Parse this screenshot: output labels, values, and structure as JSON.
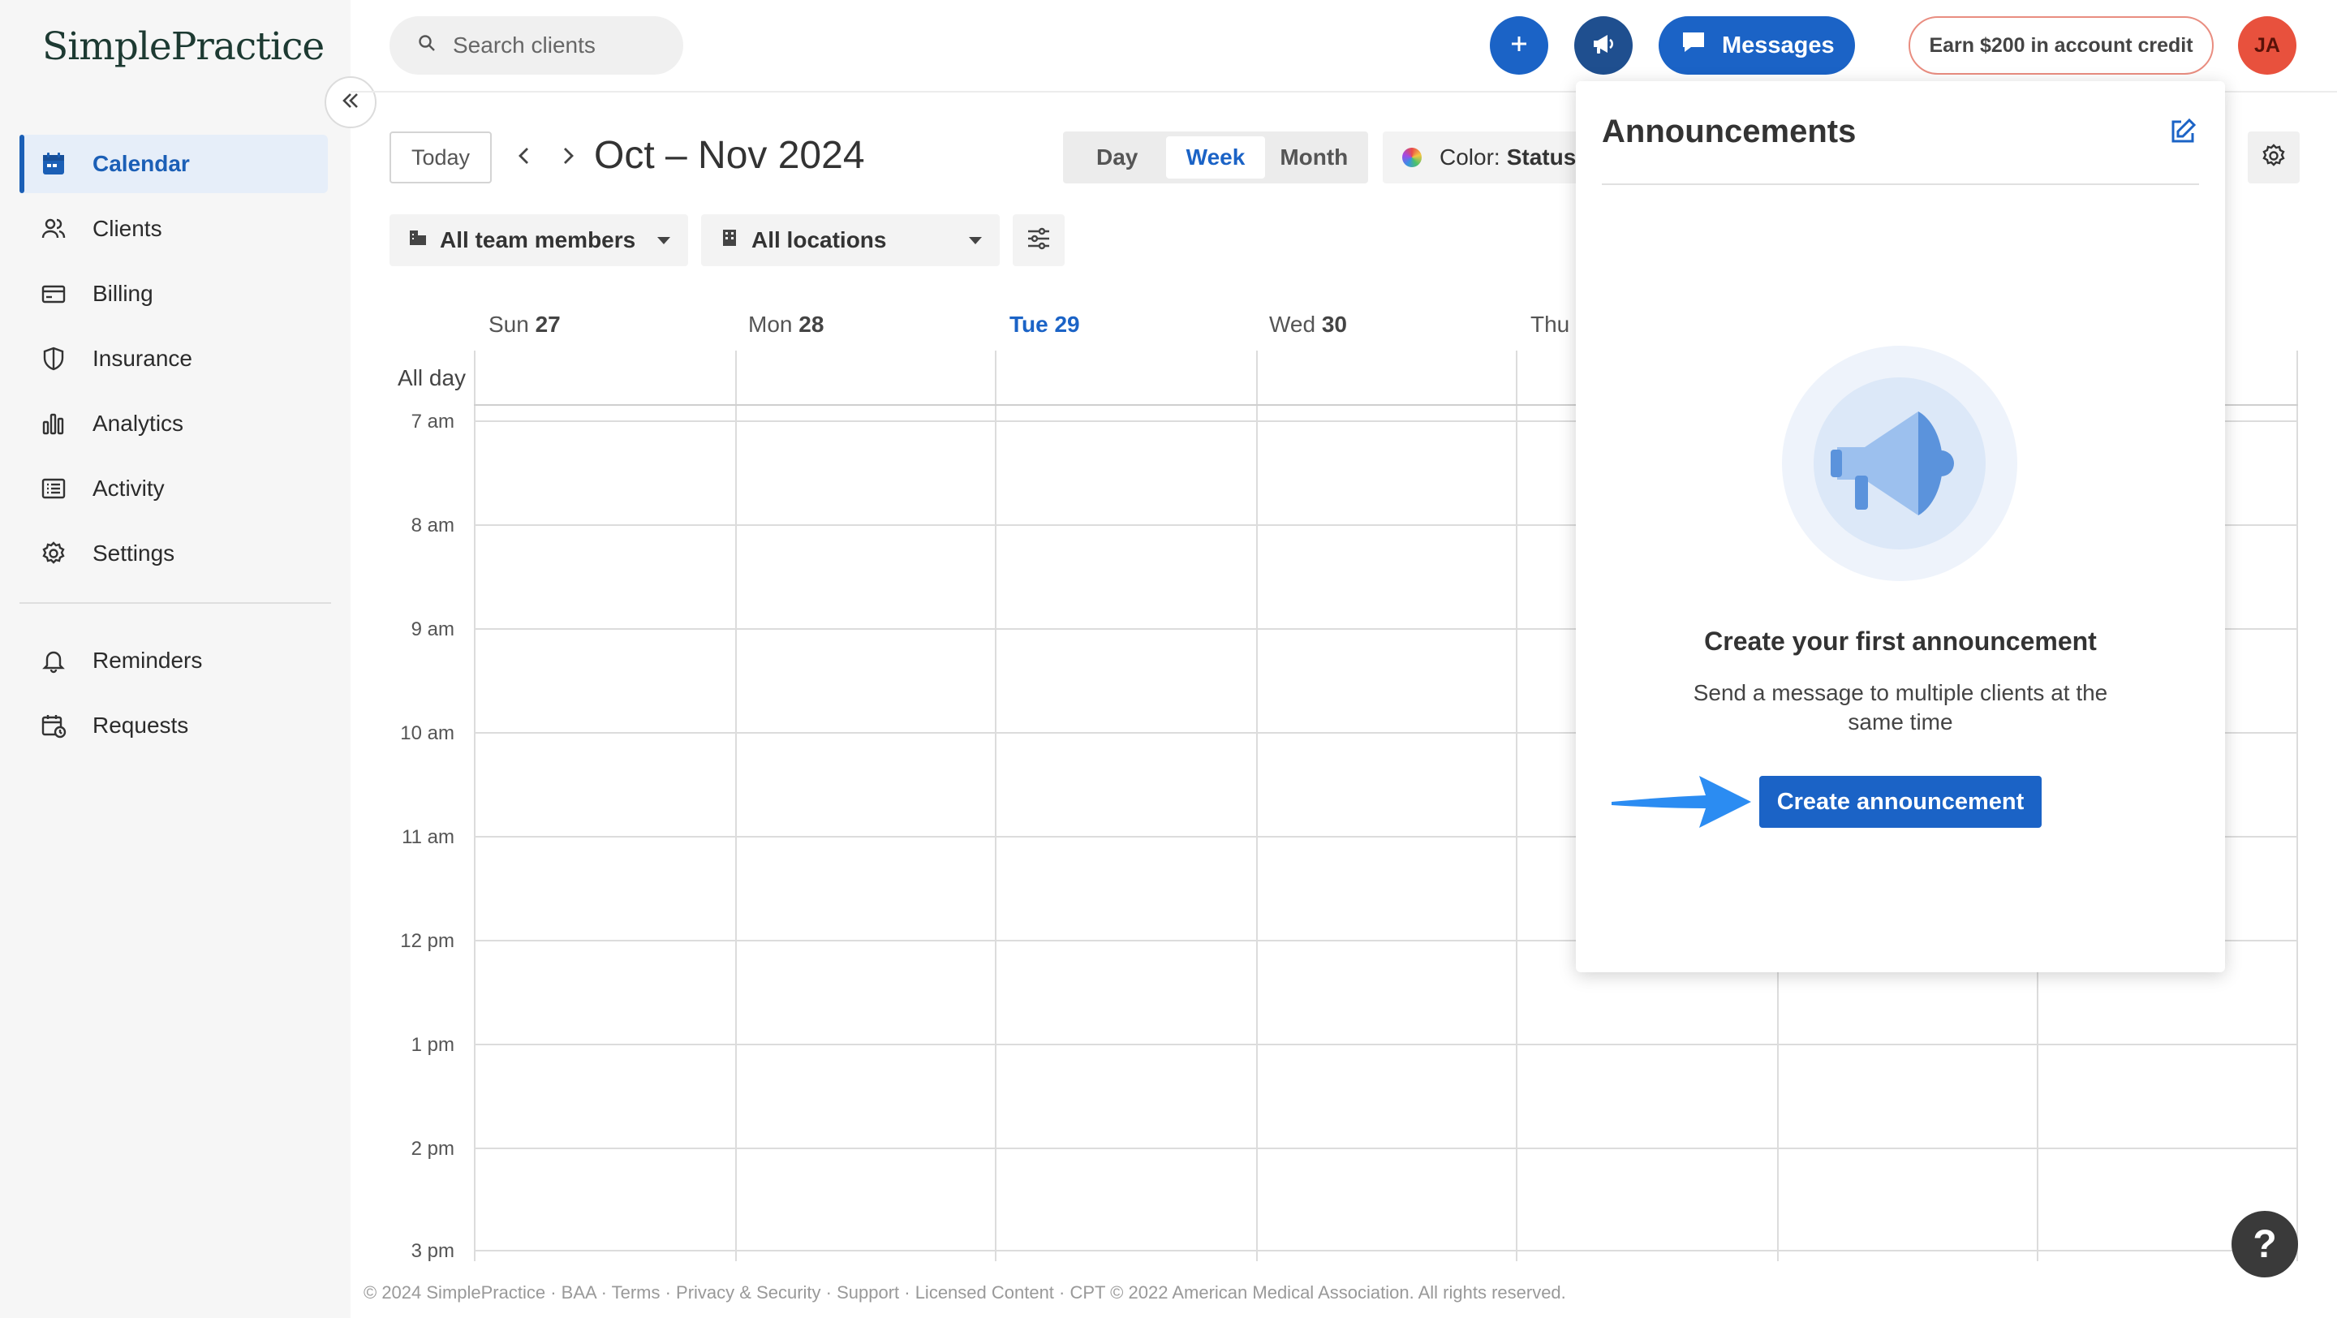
{
  "app": {
    "logo_text": "SimplePractice"
  },
  "sidebar": {
    "items": [
      {
        "label": "Calendar",
        "icon": "calendar-icon",
        "active": true
      },
      {
        "label": "Clients",
        "icon": "clients-icon"
      },
      {
        "label": "Billing",
        "icon": "billing-icon"
      },
      {
        "label": "Insurance",
        "icon": "shield-icon"
      },
      {
        "label": "Analytics",
        "icon": "bar-chart-icon"
      },
      {
        "label": "Activity",
        "icon": "activity-list-icon"
      },
      {
        "label": "Settings",
        "icon": "gear-icon"
      }
    ],
    "secondary_items": [
      {
        "label": "Reminders",
        "icon": "bell-icon"
      },
      {
        "label": "Requests",
        "icon": "calendar-request-icon"
      }
    ]
  },
  "topbar": {
    "search_placeholder": "Search clients",
    "messages_label": "Messages",
    "earn_label": "Earn $200 in account credit",
    "avatar_initials": "JA"
  },
  "toolbar": {
    "today_label": "Today",
    "range_title": "Oct – Nov 2024",
    "views": [
      "Day",
      "Week",
      "Month"
    ],
    "active_view": "Week",
    "color_label": "Color:",
    "color_value": "Status",
    "team_filter": "All team members",
    "location_filter": "All locations"
  },
  "calendar": {
    "all_day_label": "All day",
    "days": [
      {
        "name": "Sun",
        "num": "27"
      },
      {
        "name": "Mon",
        "num": "28"
      },
      {
        "name": "Tue",
        "num": "29",
        "today": true
      },
      {
        "name": "Wed",
        "num": "30"
      },
      {
        "name": "Thu",
        "num": ""
      }
    ],
    "times": [
      "7 am",
      "8 am",
      "9 am",
      "10 am",
      "11 am",
      "12 pm",
      "1 pm",
      "2 pm",
      "3 pm"
    ]
  },
  "announcements_panel": {
    "title": "Announcements",
    "heading": "Create your first announcement",
    "subtext": "Send a message to multiple clients at the same time",
    "button_label": "Create announcement"
  },
  "help_label": "?",
  "footer_text": "© 2024 SimplePractice · BAA · Terms · Privacy & Security · Support · Licensed Content · CPT © 2022 American Medical Association. All rights reserved.",
  "colors": {
    "primary": "#1b63c6",
    "avatar": "#e8513d",
    "sidebar_bg": "#f6f6f6"
  }
}
